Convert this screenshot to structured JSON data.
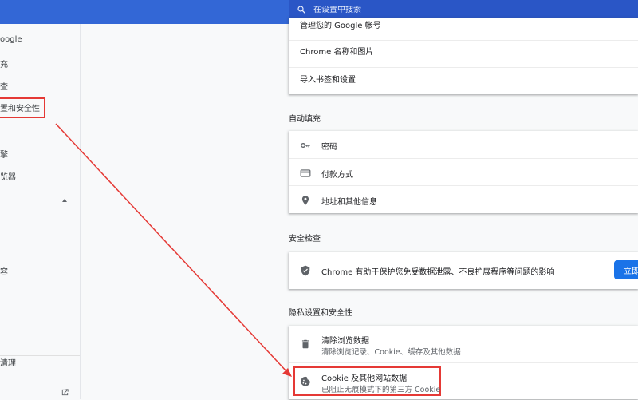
{
  "search": {
    "placeholder": "在设置中搜索"
  },
  "sidebar": {
    "items": [
      {
        "label": "oogle"
      },
      {
        "label": "充"
      },
      {
        "label": "查"
      },
      {
        "label": "置和安全性"
      },
      {
        "label": "擎"
      },
      {
        "label": "览器"
      },
      {
        "label": "容"
      },
      {
        "label": "清理"
      }
    ]
  },
  "you_google": {
    "rows": [
      {
        "label": "管理您的 Google 帐号"
      },
      {
        "label": "Chrome 名称和图片"
      },
      {
        "label": "导入书签和设置"
      }
    ]
  },
  "autofill": {
    "title": "自动填充",
    "rows": [
      {
        "label": "密码",
        "icon": "key-icon"
      },
      {
        "label": "付款方式",
        "icon": "credit-card-icon"
      },
      {
        "label": "地址和其他信息",
        "icon": "location-pin-icon"
      }
    ]
  },
  "safety_check": {
    "title": "安全检查",
    "text": "Chrome 有助于保护您免受数据泄露、不良扩展程序等问题的影响",
    "button": "立即"
  },
  "privacy": {
    "title": "隐私设置和安全性",
    "rows": [
      {
        "label": "清除浏览数据",
        "sub": "清除浏览记录、Cookie、缓存及其他数据",
        "icon": "trash-icon"
      },
      {
        "label": "Cookie 及其他网站数据",
        "sub": "已阻止无痕模式下的第三方 Cookie",
        "icon": "cookie-icon"
      }
    ]
  },
  "colors": {
    "header": "#3367d6",
    "search_bg": "#2a56c6",
    "accent": "#1a73e8",
    "annotation": "#e53935"
  }
}
